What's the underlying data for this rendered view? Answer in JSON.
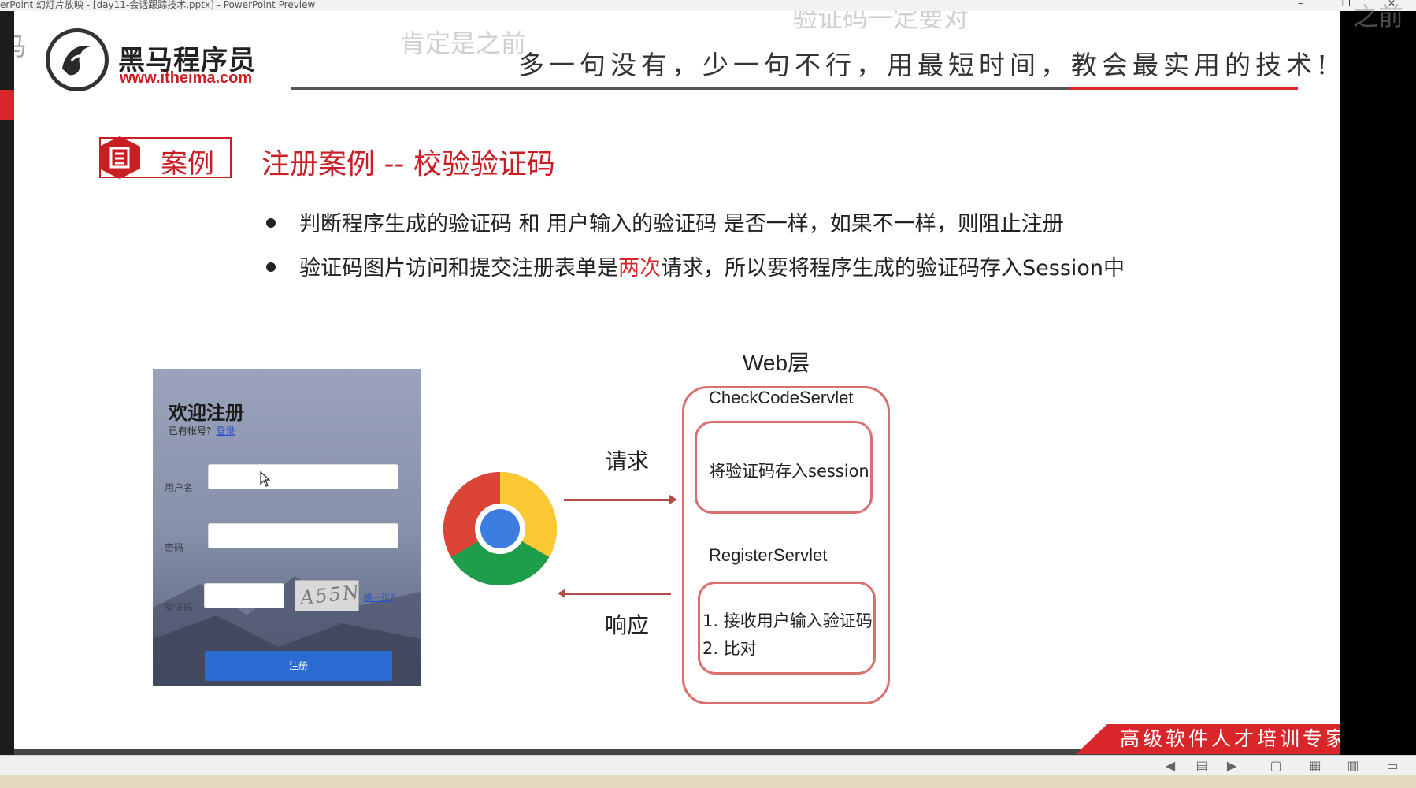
{
  "window": {
    "title": "erPoint 幻灯片放映 - [day11-会话跟踪技术.pptx] - PowerPoint Preview",
    "minimize_icon": "minimize-icon",
    "restore_icon": "restore-icon",
    "close_icon": "close-icon"
  },
  "overlays": {
    "top_center": "肯定是之前",
    "top_right": "验证码一定要对",
    "far_right": "之前",
    "left_fragment": "马"
  },
  "header": {
    "logo_cn": "黑马程序员",
    "logo_url": "www.itheima.com",
    "slogan": "多一句没有，少一句不行，用最短时间，教会最实用的技术!"
  },
  "section": {
    "badge_label": "案例",
    "title": "注册案例 -- 校验验证码"
  },
  "bullets": [
    {
      "text": "判断程序生成的验证码 和 用户输入的验证码 是否一样，如果不一样，则阻止注册"
    },
    {
      "pre": "验证码图片访问和提交注册表单是",
      "highlight": "两次",
      "post": "请求，所以要将程序生成的验证码存入Session中"
    }
  ],
  "register_form": {
    "title": "欢迎注册",
    "subtitle": "已有帐号?",
    "login_link": "登录",
    "username_label": "用户名",
    "password_label": "密码",
    "captcha_label": "验证码",
    "captcha_text": "A55N",
    "change_link": "换一张?",
    "submit_button": "注册"
  },
  "diagram": {
    "request_label": "请求",
    "response_label": "响应",
    "web_layer_label": "Web层",
    "servlet1": {
      "name": "CheckCodeServlet",
      "action": "将验证码存入session"
    },
    "servlet2": {
      "name": "RegisterServlet",
      "step1": "1. 接收用户输入验证码",
      "step2": "2. 比对"
    }
  },
  "footer": {
    "tagline": "高级软件人才培训专家"
  },
  "statusbar": {
    "icons": [
      "prev-slide-icon",
      "notes-icon",
      "next-slide-icon",
      "normal-view-icon",
      "slide-sorter-icon",
      "reading-view-icon",
      "slideshow-icon"
    ]
  },
  "colors": {
    "accent_red": "#d8262b",
    "diagram_border": "#d9706e",
    "button_blue": "#2c6bd2"
  }
}
